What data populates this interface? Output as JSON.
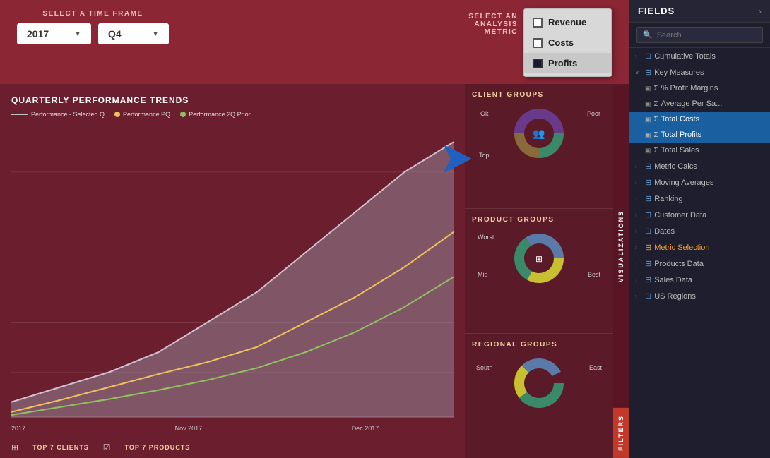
{
  "header": {
    "timeframe_label": "SELECT A TIME FRAME",
    "year_value": "2017",
    "quarter_value": "Q4",
    "metric_label_line1": "SELECT AN",
    "metric_label_line2": "ANALYSIS",
    "metric_label_line3": "METRIC"
  },
  "metric_popup": {
    "items": [
      {
        "label": "Revenue",
        "checked": false
      },
      {
        "label": "Costs",
        "checked": false
      },
      {
        "label": "Profits",
        "checked": true
      }
    ]
  },
  "chart": {
    "title": "QUARTERLY PERFORMANCE TRENDS",
    "legend": [
      {
        "label": "Performance - Selected Q",
        "color": "#c0c0c0"
      },
      {
        "label": "Performance PQ",
        "color": "#f0c060"
      },
      {
        "label": "Performance 2Q Prior",
        "color": "#90c060"
      }
    ],
    "x_labels": [
      "2017",
      "",
      "Nov 2017",
      "",
      "Dec 2017",
      ""
    ]
  },
  "groups": {
    "client_groups": {
      "title": "CLIENT GROUPS",
      "labels": {
        "ok": "Ok",
        "poor": "Poor",
        "top": "Top"
      }
    },
    "product_groups": {
      "title": "PRODUCT GROUPS",
      "labels": {
        "worst": "Worst",
        "mid": "Mid",
        "best": "Best"
      }
    },
    "regional_groups": {
      "title": "REGIONAL GROUPS",
      "labels": {
        "south": "South",
        "east": "East"
      }
    }
  },
  "bottom": {
    "item1": "TOP 7 CLIENTS",
    "item2": "TOP 7 PRODUCTS"
  },
  "side_tabs": {
    "visualizations": "VISUALIZATIONS",
    "filters": "FILTERS"
  },
  "fields_panel": {
    "title": "FIELDS",
    "search_placeholder": "Search",
    "items": [
      {
        "type": "expandable",
        "label": "Cumulative Totals",
        "icon": "table",
        "expanded": false,
        "level": 0
      },
      {
        "type": "expandable",
        "label": "Key Measures",
        "icon": "table",
        "expanded": true,
        "level": 0
      },
      {
        "type": "leaf",
        "label": "% Profit Margins",
        "icon": "sigma",
        "level": 1
      },
      {
        "type": "leaf",
        "label": "Average Per Sa...",
        "icon": "sigma",
        "level": 1
      },
      {
        "type": "leaf",
        "label": "Total Costs",
        "icon": "sigma",
        "level": 1,
        "selected": true
      },
      {
        "type": "leaf",
        "label": "Total Profits",
        "icon": "sigma",
        "level": 1,
        "selected": true
      },
      {
        "type": "leaf",
        "label": "Total Sales",
        "icon": "sigma",
        "level": 1
      },
      {
        "type": "expandable",
        "label": "Metric Calcs",
        "icon": "table",
        "expanded": false,
        "level": 0
      },
      {
        "type": "expandable",
        "label": "Moving Averages",
        "icon": "table",
        "expanded": false,
        "level": 0
      },
      {
        "type": "expandable",
        "label": "Ranking",
        "icon": "table",
        "expanded": false,
        "level": 0
      },
      {
        "type": "expandable",
        "label": "Customer Data",
        "icon": "grid",
        "expanded": false,
        "level": 0
      },
      {
        "type": "expandable",
        "label": "Dates",
        "icon": "grid",
        "expanded": false,
        "level": 0
      },
      {
        "type": "expandable",
        "label": "Metric Selection",
        "icon": "grid",
        "expanded": false,
        "level": 0,
        "special": "metric"
      },
      {
        "type": "expandable",
        "label": "Products Data",
        "icon": "grid",
        "expanded": false,
        "level": 0
      },
      {
        "type": "expandable",
        "label": "Sales Data",
        "icon": "grid",
        "expanded": false,
        "level": 0
      },
      {
        "type": "expandable",
        "label": "US Regions",
        "icon": "grid",
        "expanded": false,
        "level": 0
      }
    ]
  },
  "colors": {
    "dashboard_bg": "#8b2635",
    "chart_bg": "#6b1e2d",
    "fields_bg": "#1e1e2e",
    "selected_row": "#1a5fa0"
  }
}
